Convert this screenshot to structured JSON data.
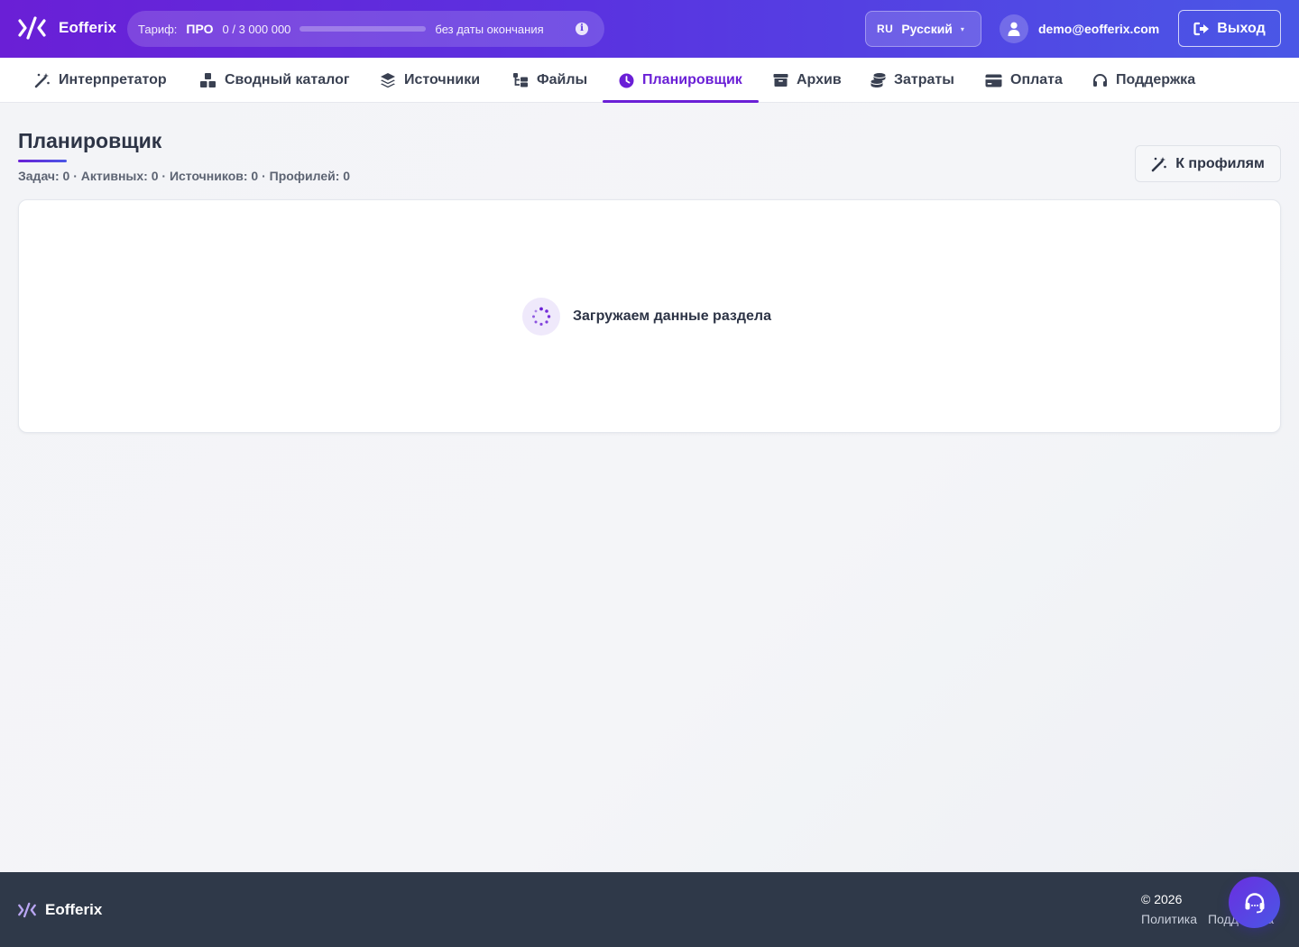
{
  "app": {
    "brand": "Eofferix"
  },
  "tariff": {
    "label": "Тариф:",
    "plan": "ПРО",
    "usage": "0 / 3 000 000",
    "usage_fraction": 0,
    "expiry": "без даты окончания",
    "info_icon": "info-icon"
  },
  "language": {
    "code": "RU",
    "name": "Русский",
    "caret": "▾"
  },
  "user": {
    "email": "demo@eofferix.com"
  },
  "logout": {
    "label": "Выход"
  },
  "nav": {
    "items": [
      {
        "label": "Интерпретатор",
        "icon": "magic-wand-icon"
      },
      {
        "label": "Сводный каталог",
        "icon": "boxes-icon"
      },
      {
        "label": "Источники",
        "icon": "layers-icon"
      },
      {
        "label": "Файлы",
        "icon": "folder-tree-icon"
      },
      {
        "label": "Планировщик",
        "icon": "clock-icon",
        "active": true
      },
      {
        "label": "Архив",
        "icon": "archive-icon"
      },
      {
        "label": "Затраты",
        "icon": "coins-icon"
      },
      {
        "label": "Оплата",
        "icon": "credit-card-icon"
      },
      {
        "label": "Поддержка",
        "icon": "headset-icon"
      }
    ]
  },
  "page": {
    "title": "Планировщик",
    "stats": "Задач: 0 · Активных: 0 · Источников: 0 · Профилей: 0",
    "to_profiles_label": "К профилям"
  },
  "card": {
    "loading_text": "Загружаем данные раздела"
  },
  "footer": {
    "brand": "Eofferix",
    "copyright": "© 2026",
    "links": [
      "Политика",
      "Поддержка"
    ]
  },
  "colors": {
    "accent": "#6a1fd6",
    "header_gradient_start": "#6a1fd6",
    "header_gradient_end": "#4a57e6",
    "footer_bg": "#2f3949"
  }
}
